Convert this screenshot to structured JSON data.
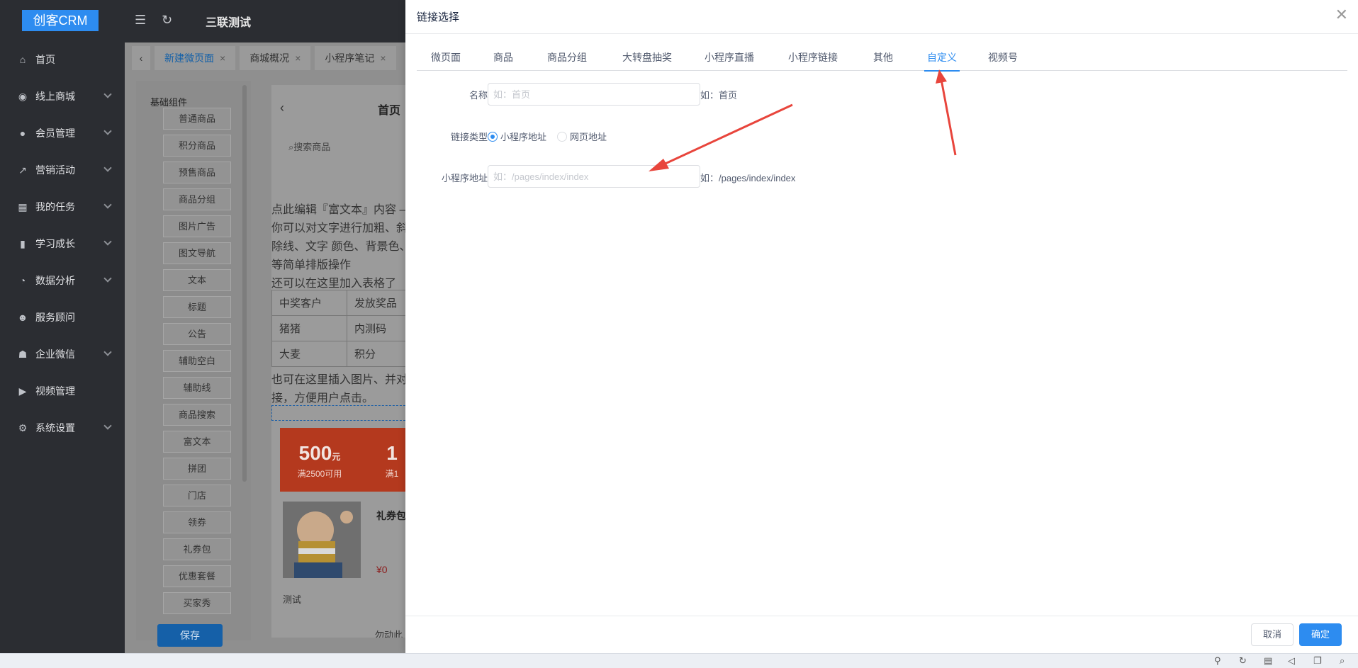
{
  "app": {
    "logo": "创客CRM",
    "header_title": "三联测试"
  },
  "sidebar": {
    "items": [
      {
        "label": "首页",
        "icon": "home-icon",
        "glyph": "⌂",
        "expandable": false
      },
      {
        "label": "线上商城",
        "icon": "shop-icon",
        "glyph": "◉",
        "expandable": true
      },
      {
        "label": "会员管理",
        "icon": "user-icon",
        "glyph": "●",
        "expandable": true
      },
      {
        "label": "营销活动",
        "icon": "trend-icon",
        "glyph": "↗",
        "expandable": true
      },
      {
        "label": "我的任务",
        "icon": "grid-icon",
        "glyph": "▦",
        "expandable": true
      },
      {
        "label": "学习成长",
        "icon": "book-icon",
        "glyph": "▮",
        "expandable": true
      },
      {
        "label": "数据分析",
        "icon": "pie-icon",
        "glyph": "◔",
        "expandable": true
      },
      {
        "label": "服务顾问",
        "icon": "team-icon",
        "glyph": "☻",
        "expandable": false
      },
      {
        "label": "企业微信",
        "icon": "group-icon",
        "glyph": "☗",
        "expandable": true
      },
      {
        "label": "视频管理",
        "icon": "video-icon",
        "glyph": "▶",
        "expandable": false
      },
      {
        "label": "系统设置",
        "icon": "gear-icon",
        "glyph": "⚙",
        "expandable": true
      }
    ]
  },
  "tabs": [
    {
      "label": "新建微页面",
      "active": true
    },
    {
      "label": "商城概况",
      "active": false
    },
    {
      "label": "小程序笔记",
      "active": false
    }
  ],
  "components": {
    "heading": "基础组件",
    "items": [
      "普通商品",
      "积分商品",
      "预售商品",
      "商品分组",
      "图片广告",
      "图文导航",
      "文本",
      "标题",
      "公告",
      "辅助空白",
      "辅助线",
      "商品搜索",
      "富文本",
      "拼团",
      "门店",
      "领券",
      "礼券包",
      "优惠套餐",
      "买家秀"
    ],
    "save_label": "保存"
  },
  "phone": {
    "title": "首页",
    "search_placeholder": "搜索商品",
    "rich_lines": [
      "点此编辑『富文本』内容 —",
      "你可以对文字进行加粗、斜",
      "除线、文字 颜色、背景色、",
      "等简单排版操作",
      "还可以在这里加入表格了"
    ],
    "table": [
      [
        "中奖客户",
        "发放奖品"
      ],
      [
        "猪猪",
        "内测码"
      ],
      [
        "大麦",
        "积分"
      ]
    ],
    "rich_lines2": [
      "也可在这里插入图片、并对",
      "接，方便用户点击。"
    ],
    "coupons": [
      {
        "amount": "500",
        "unit": "元",
        "cond": "满2500可用"
      },
      {
        "amount": "1",
        "unit": "",
        "cond": "满1"
      }
    ],
    "goods_name": "礼券包",
    "goods_price": "¥0",
    "goods_tag": "测试",
    "goods_foot": "勿动此"
  },
  "dialog": {
    "title": "链接选择",
    "tabs": [
      {
        "label": "微页面",
        "active": false
      },
      {
        "label": "商品",
        "active": false
      },
      {
        "label": "商品分组",
        "active": false
      },
      {
        "label": "大转盘抽奖",
        "active": false
      },
      {
        "label": "小程序直播",
        "active": false
      },
      {
        "label": "小程序链接",
        "active": false
      },
      {
        "label": "其他",
        "active": false
      },
      {
        "label": "自定义",
        "active": true
      },
      {
        "label": "视频号",
        "active": false
      }
    ],
    "form": {
      "name_label": "名称",
      "name_placeholder": "如：首页",
      "name_value": "",
      "name_hint": "如：首页",
      "type_label": "链接类型",
      "type_options": [
        {
          "label": "小程序地址",
          "selected": true
        },
        {
          "label": "网页地址",
          "selected": false
        }
      ],
      "path_label": "小程序地址",
      "path_placeholder": "如：/pages/index/index",
      "path_value": "",
      "path_hint": "如：/pages/index/index"
    },
    "cancel_label": "取消",
    "ok_label": "确定"
  },
  "annotation_color": "#e8453c"
}
